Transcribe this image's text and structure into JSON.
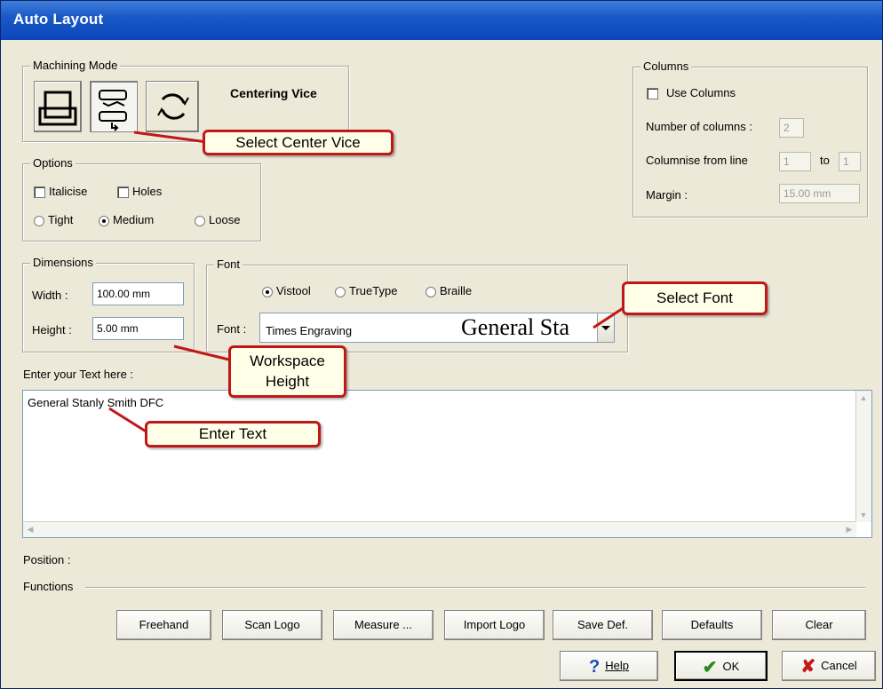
{
  "window": {
    "title": "Auto Layout"
  },
  "machining_mode": {
    "legend": "Machining Mode",
    "mode_label": "Centering Vice",
    "buttons": [
      {
        "icon": "flat-square-mode-icon",
        "selected": false
      },
      {
        "icon": "centering-vice-icon",
        "selected": true
      },
      {
        "icon": "rotary-circle-icon",
        "selected": false
      }
    ]
  },
  "options": {
    "legend": "Options",
    "italicise": {
      "label": "Italicise",
      "checked": false
    },
    "holes": {
      "label": "Holes",
      "checked": false
    },
    "spacing": [
      {
        "label": "Tight",
        "selected": false
      },
      {
        "label": "Medium",
        "selected": true
      },
      {
        "label": "Loose",
        "selected": false
      }
    ]
  },
  "columns": {
    "legend": "Columns",
    "use_columns": {
      "label": "Use Columns",
      "checked": false
    },
    "number_label": "Number of columns :",
    "number_value": "2",
    "columnise_label": "Columnise from line",
    "from_value": "1",
    "to_label": "to",
    "to_value": "1",
    "margin_label": "Margin :",
    "margin_value": "15.00 mm"
  },
  "dimensions": {
    "legend": "Dimensions",
    "width_label": "Width :",
    "width_value": "100.00 mm",
    "height_label": "Height :",
    "height_value": "5.00 mm"
  },
  "font": {
    "legend": "Font",
    "types": [
      {
        "label": "Vistool",
        "selected": true
      },
      {
        "label": "TrueType",
        "selected": false
      },
      {
        "label": "Braille",
        "selected": false
      }
    ],
    "font_label": "Font :",
    "font_value": "Times Engraving",
    "preview": "General Sta"
  },
  "text_entry": {
    "label": "Enter your Text here :",
    "value": "General Stanly Smith DFC"
  },
  "position_label": "Position :",
  "functions": {
    "label": "Functions",
    "buttons": [
      "Freehand",
      "Scan Logo",
      "Measure ...",
      "Import Logo",
      "Save Def.",
      "Defaults",
      "Clear"
    ]
  },
  "dialog_buttons": {
    "help": "Help",
    "ok": "OK",
    "cancel": "Cancel"
  },
  "callouts": {
    "select_center_vice": "Select Center Vice",
    "select_font": "Select Font",
    "workspace_height_line1": "Workspace",
    "workspace_height_line2": "Height",
    "enter_text": "Enter Text"
  },
  "colors": {
    "title_bar": "#0b46b8",
    "callout_border": "#c01818",
    "callout_fill": "#ffffe8",
    "ok_check": "#2a8a1c",
    "cancel_x": "#c41a1a",
    "help_icon": "#1f4fb8"
  }
}
